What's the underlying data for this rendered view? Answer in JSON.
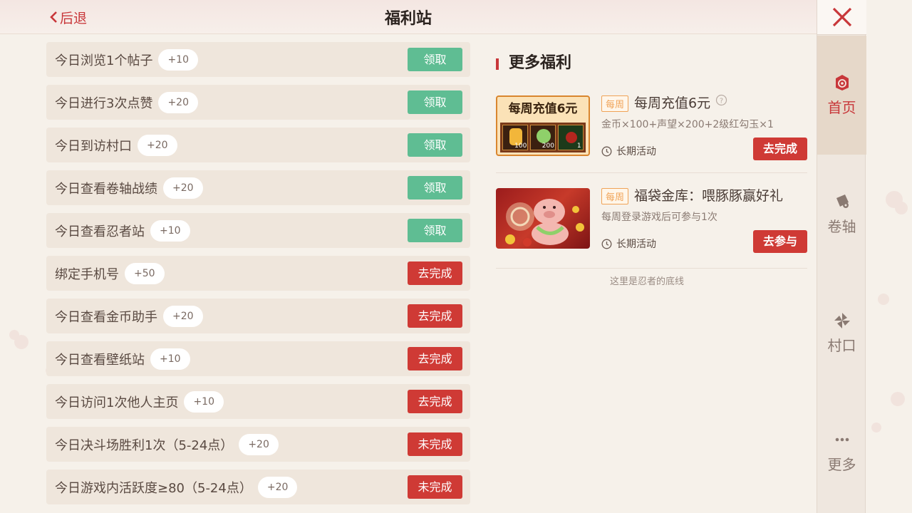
{
  "header": {
    "back_label": "后退",
    "title": "福利站"
  },
  "tasks": [
    {
      "name": "今日浏览1个帖子",
      "points": "+10",
      "action": "领取",
      "status": "claim"
    },
    {
      "name": "今日进行3次点赞",
      "points": "+20",
      "action": "领取",
      "status": "claim"
    },
    {
      "name": "今日到访村口",
      "points": "+20",
      "action": "领取",
      "status": "claim"
    },
    {
      "name": "今日查看卷轴战绩",
      "points": "+20",
      "action": "领取",
      "status": "claim"
    },
    {
      "name": "今日查看忍者站",
      "points": "+10",
      "action": "领取",
      "status": "claim"
    },
    {
      "name": "绑定手机号",
      "points": "+50",
      "action": "去完成",
      "status": "go"
    },
    {
      "name": "今日查看金币助手",
      "points": "+20",
      "action": "去完成",
      "status": "go"
    },
    {
      "name": "今日查看壁纸站",
      "points": "+10",
      "action": "去完成",
      "status": "go"
    },
    {
      "name": "今日访问1次他人主页",
      "points": "+10",
      "action": "去完成",
      "status": "go"
    },
    {
      "name": "今日决斗场胜利1次（5-24点）",
      "points": "+20",
      "action": "未完成",
      "status": "go"
    },
    {
      "name": "今日游戏内活跃度≥80（5-24点）",
      "points": "+20",
      "action": "未完成",
      "status": "go"
    }
  ],
  "more": {
    "title": "更多福利",
    "promos": [
      {
        "tag": "每周",
        "title": "每周充值6元",
        "desc": "金币×100+声望×200+2级红勾玉×1",
        "time": "长期活动",
        "action": "去完成",
        "image_title": "每周充值6元",
        "image_counts": [
          "100",
          "200",
          "1"
        ]
      },
      {
        "tag": "每周",
        "title": "福袋金库：喂豚豚赢好礼",
        "desc": "每周登录游戏后可参与1次",
        "time": "长期活动",
        "action": "去参与"
      }
    ],
    "footer_note": "这里是忍者的底线"
  },
  "sidebar": {
    "items": [
      {
        "label": "首页",
        "icon": "home-icon",
        "active": true
      },
      {
        "label": "卷轴",
        "icon": "scroll-icon",
        "active": false
      },
      {
        "label": "村口",
        "icon": "pinwheel-icon",
        "active": false
      },
      {
        "label": "更多",
        "icon": "more-icon",
        "active": false
      }
    ]
  },
  "colors": {
    "accent": "#c8373a",
    "claim_green": "#5fbd93",
    "go_red": "#cf3a35",
    "tag_orange": "#f0a357"
  }
}
